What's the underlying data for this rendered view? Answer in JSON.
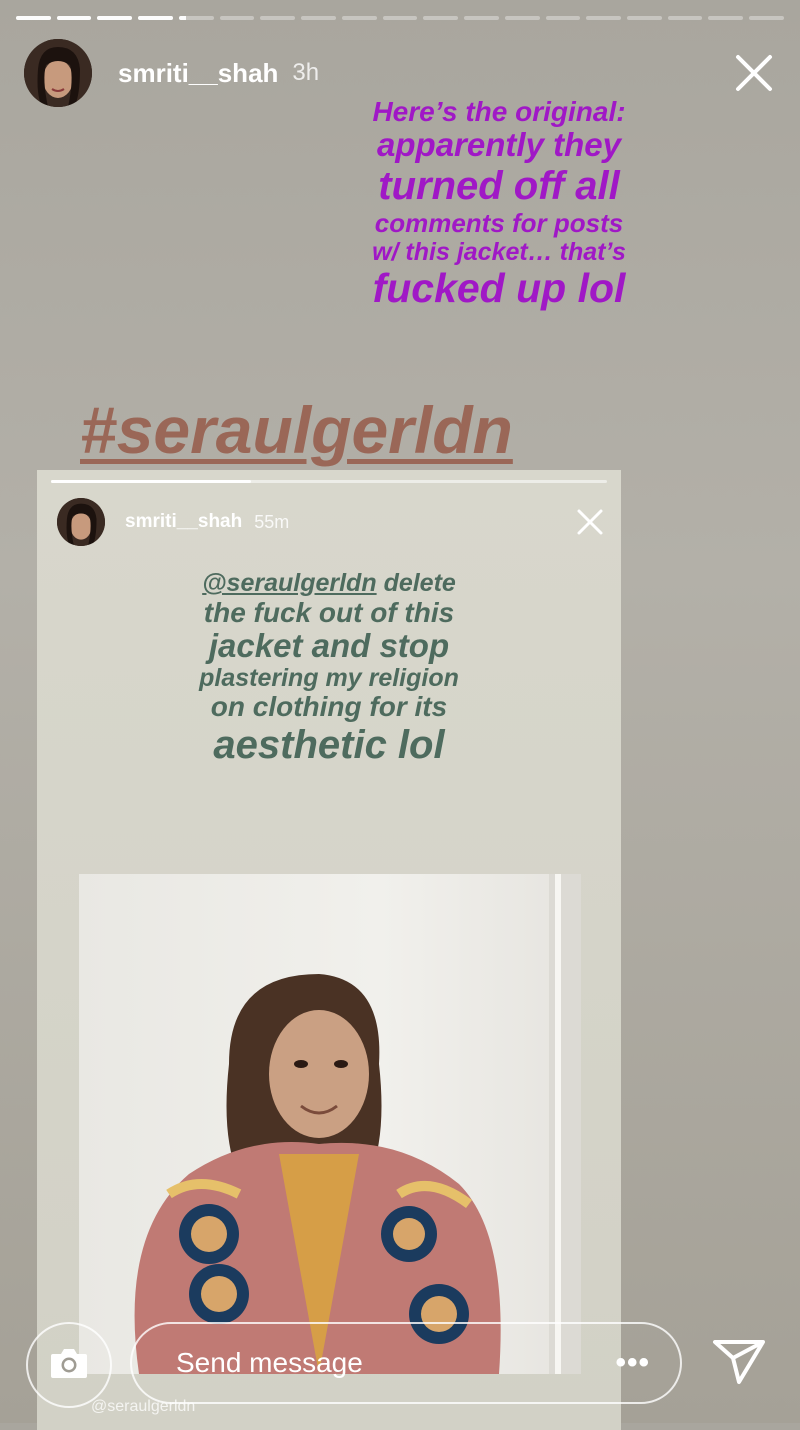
{
  "story": {
    "progress_segments": 19,
    "active_segment_index": 4,
    "active_segment_fill": 0.2,
    "username": "smriti__shah",
    "time_ago": "3h"
  },
  "overlay": {
    "lines": [
      "Here’s the original:",
      "apparently they",
      "turned off all",
      "comments for posts",
      "w/ this jacket… that’s",
      "fucked up lol"
    ],
    "color": "#a018c6"
  },
  "hashtag": "#seraulgerldn",
  "embedded_story": {
    "username": "smriti__shah",
    "time_ago": "55m",
    "progress_fill": 0.36,
    "text_lines": [
      "@seraulgerldn delete",
      "the fuck out of this",
      "jacket and stop",
      "plastering my religion",
      "on clothing for its",
      "aesthetic lol"
    ],
    "mention": "@seraulgerldn",
    "photo_credit": "@seraulgerldn",
    "text_color": "#4e6b5e"
  },
  "composer": {
    "placeholder": "Send message",
    "more_icon": "more-dots-icon",
    "camera_icon": "camera-icon",
    "send_icon": "send-icon"
  }
}
